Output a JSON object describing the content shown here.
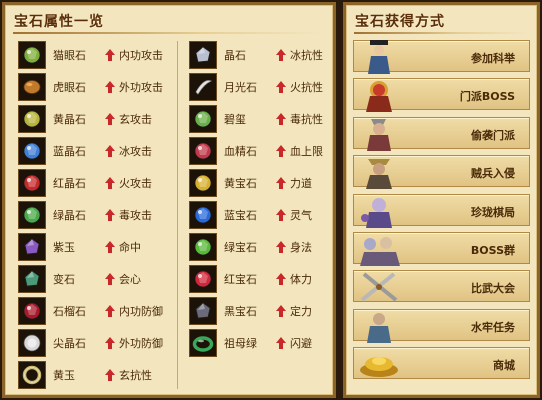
{
  "left_panel": {
    "title": "宝石属性一览",
    "col1": [
      {
        "name": "猫眼石",
        "attr": "内功攻击",
        "icon": "cat-eye-gem-icon",
        "color": "#7fae3a"
      },
      {
        "name": "虎眼石",
        "attr": "外功攻击",
        "icon": "tiger-eye-gem-icon",
        "color": "#c07a2a"
      },
      {
        "name": "黄晶石",
        "attr": "玄攻击",
        "icon": "yellow-crystal-gem-icon",
        "color": "#b8b43a"
      },
      {
        "name": "蓝晶石",
        "attr": "冰攻击",
        "icon": "blue-crystal-gem-icon",
        "color": "#3f7fd6"
      },
      {
        "name": "红晶石",
        "attr": "火攻击",
        "icon": "red-crystal-gem-icon",
        "color": "#c42a2a"
      },
      {
        "name": "绿晶石",
        "attr": "毒攻击",
        "icon": "green-crystal-gem-icon",
        "color": "#4aa84a"
      },
      {
        "name": "紫玉",
        "attr": "命中",
        "icon": "purple-jade-gem-icon",
        "color": "#8a5ac2"
      },
      {
        "name": "变石",
        "attr": "会心",
        "icon": "alexandrite-gem-icon",
        "color": "#4a9a7a"
      },
      {
        "name": "石榴石",
        "attr": "内功防御",
        "icon": "garnet-gem-icon",
        "color": "#a81a2a"
      },
      {
        "name": "尖晶石",
        "attr": "外功防御",
        "icon": "spinel-gem-icon",
        "color": "#d8d8d8"
      },
      {
        "name": "黄玉",
        "attr": "玄抗性",
        "icon": "topaz-ring-icon",
        "color": "#c8b86a"
      }
    ],
    "col2": [
      {
        "name": "晶石",
        "attr": "冰抗性",
        "icon": "crystal-gem-icon",
        "color": "#b8c0d0"
      },
      {
        "name": "月光石",
        "attr": "火抗性",
        "icon": "moonstone-gem-icon",
        "color": "#e6e6e6"
      },
      {
        "name": "碧玺",
        "attr": "毒抗性",
        "icon": "tourmaline-gem-icon",
        "color": "#6ab04a"
      },
      {
        "name": "血精石",
        "attr": "血上限",
        "icon": "bloodstone-gem-icon",
        "color": "#c23a4a"
      },
      {
        "name": "黄宝石",
        "attr": "力道",
        "icon": "yellow-sapphire-gem-icon",
        "color": "#d8b030"
      },
      {
        "name": "蓝宝石",
        "attr": "灵气",
        "icon": "sapphire-gem-icon",
        "color": "#2a6ad8"
      },
      {
        "name": "绿宝石",
        "attr": "身法",
        "icon": "emerald-gem-icon",
        "color": "#5ab83a"
      },
      {
        "name": "红宝石",
        "attr": "体力",
        "icon": "ruby-gem-icon",
        "color": "#d0283a"
      },
      {
        "name": "黑宝石",
        "attr": "定力",
        "icon": "black-gem-icon",
        "color": "#6a6a7a"
      },
      {
        "name": "祖母绿",
        "attr": "闪避",
        "icon": "jade-bangle-icon",
        "color": "#3aa85a"
      }
    ]
  },
  "right_panel": {
    "title": "宝石获得方式",
    "items": [
      {
        "label": "参加科举",
        "icon": "scholar-official-icon"
      },
      {
        "label": "门派BOSS",
        "icon": "sect-boss-icon"
      },
      {
        "label": "偷袭门派",
        "icon": "raider-icon"
      },
      {
        "label": "贼兵入侵",
        "icon": "bandit-soldier-icon"
      },
      {
        "label": "珍珑棋局",
        "icon": "chess-master-icon"
      },
      {
        "label": "BOSS群",
        "icon": "boss-group-icon"
      },
      {
        "label": "比武大会",
        "icon": "crossed-swords-icon"
      },
      {
        "label": "水牢任务",
        "icon": "prison-quest-icon"
      },
      {
        "label": "商城",
        "icon": "gold-ingot-icon"
      }
    ]
  },
  "colors": {
    "panel_bg": "#f3e6bf",
    "panel_border": "#8a6428",
    "title_text": "#5a2e08",
    "arrow_red": "#c8282a"
  }
}
